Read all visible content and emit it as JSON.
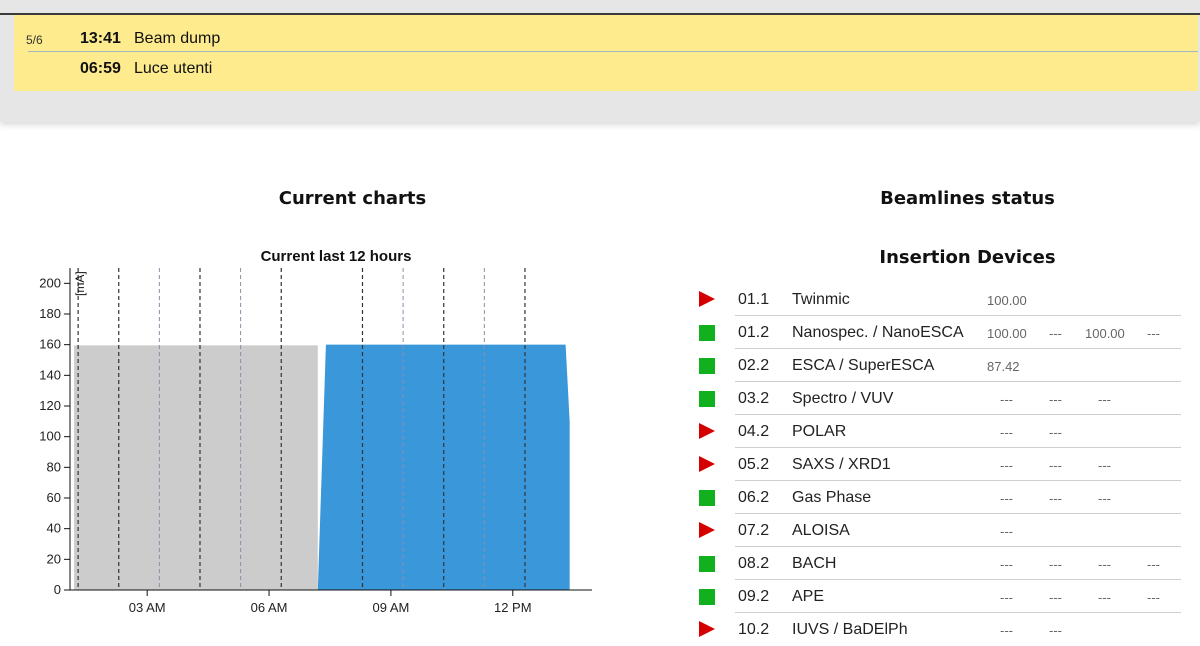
{
  "schedule": [
    {
      "day": "5/6",
      "time": "13:41",
      "text": "Beam dump"
    },
    {
      "day": "",
      "time": "06:59",
      "text": "Luce utenti"
    }
  ],
  "sections": {
    "charts_title": "Current charts",
    "beamlines_title": "Beamlines status",
    "insertion_title": "Insertion Devices"
  },
  "chart_data": {
    "type": "area",
    "title": "Current last 12 hours",
    "ylabel": "[mA]",
    "xlabel": "",
    "ylim": [
      0,
      210
    ],
    "yticks": [
      0,
      20,
      40,
      60,
      80,
      100,
      120,
      140,
      160,
      180,
      200
    ],
    "x_tick_labels": [
      "03 AM",
      "06 AM",
      "09 AM",
      "12 PM"
    ],
    "x_ticks_hours": [
      3,
      6,
      9,
      12
    ],
    "xlim_hours": [
      1.1,
      13.95
    ],
    "series": [
      {
        "x": [
          1.2,
          7.2
        ],
        "y": [
          159.5,
          159.5
        ],
        "color": "#cccccc"
      },
      {
        "x": [
          7.2,
          7.4,
          13.3,
          13.4,
          13.4
        ],
        "y": [
          0,
          160,
          160,
          110,
          0
        ],
        "color": "#3a97da"
      }
    ],
    "vlines_dashed_dark_hours": [
      1.3,
      2.3,
      4.3,
      6.3,
      8.3,
      10.3,
      12.3
    ],
    "vlines_dashed_light_hours": [
      3.3,
      5.3,
      9.3,
      11.3
    ],
    "grid": false
  },
  "beamlines": [
    {
      "status": "warn",
      "code": "01.1",
      "name": "Twinmic",
      "vals": [
        "100.00",
        "",
        "",
        ""
      ]
    },
    {
      "status": "ok",
      "code": "01.2",
      "name": "Nanospec. / NanoESCA",
      "vals": [
        "100.00",
        "---",
        "100.00",
        "---"
      ]
    },
    {
      "status": "ok",
      "code": "02.2",
      "name": "ESCA / SuperESCA",
      "vals": [
        "87.42",
        "",
        "",
        ""
      ]
    },
    {
      "status": "ok",
      "code": "03.2",
      "name": "Spectro / VUV",
      "vals": [
        "---",
        "---",
        "---",
        ""
      ]
    },
    {
      "status": "warn",
      "code": "04.2",
      "name": "POLAR",
      "vals": [
        "---",
        "---",
        "",
        ""
      ]
    },
    {
      "status": "warn",
      "code": "05.2",
      "name": "SAXS / XRD1",
      "vals": [
        "---",
        "---",
        "---",
        ""
      ]
    },
    {
      "status": "ok",
      "code": "06.2",
      "name": "Gas Phase",
      "vals": [
        "---",
        "---",
        "---",
        ""
      ]
    },
    {
      "status": "warn",
      "code": "07.2",
      "name": "ALOISA",
      "vals": [
        "---",
        "",
        "",
        ""
      ]
    },
    {
      "status": "ok",
      "code": "08.2",
      "name": "BACH",
      "vals": [
        "---",
        "---",
        "---",
        "---"
      ]
    },
    {
      "status": "ok",
      "code": "09.2",
      "name": "APE",
      "vals": [
        "---",
        "---",
        "---",
        "---"
      ]
    },
    {
      "status": "warn",
      "code": "10.2",
      "name": "IUVS / BaDElPh",
      "vals": [
        "---",
        "---",
        "",
        ""
      ]
    }
  ]
}
